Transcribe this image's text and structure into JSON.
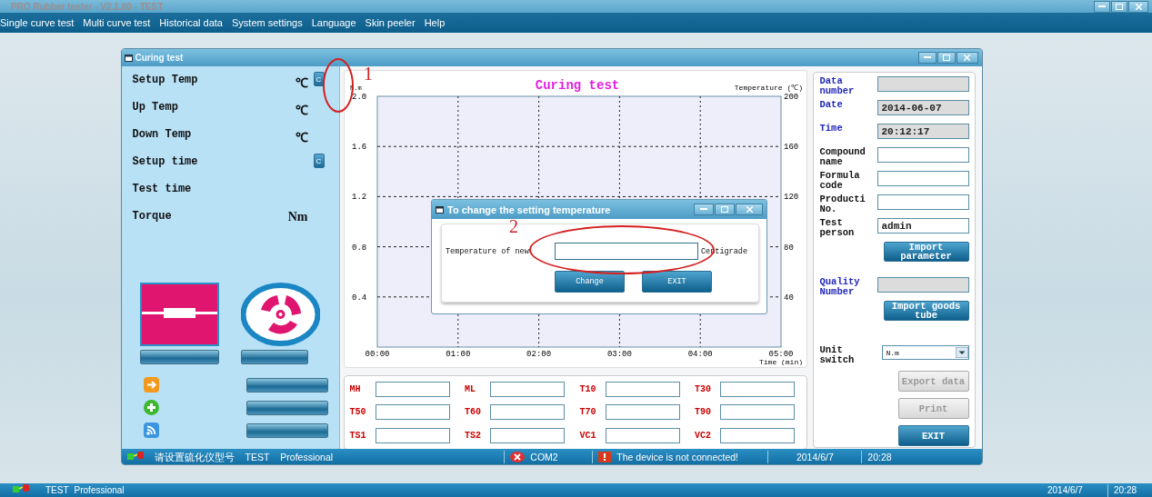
{
  "app": {
    "title": "PRO Rubber tester - V2.1.80 - TEST"
  },
  "menu": [
    "Single curve test",
    "Multi curve test",
    "Historical data",
    "System settings",
    "Language",
    "Skin peeler",
    "Help"
  ],
  "window": {
    "title": "Curing test"
  },
  "readings": [
    {
      "label": "Setup Temp",
      "unit": "℃",
      "button": "C"
    },
    {
      "label": "Up Temp",
      "unit": "℃"
    },
    {
      "label": "Down Temp",
      "unit": "℃"
    },
    {
      "label": "Setup time",
      "button": "C"
    },
    {
      "label": "Test time"
    },
    {
      "label": "Torque",
      "unit": "Nm"
    }
  ],
  "chart": {
    "right_label": "Temperature (℃)",
    "right_ticks": [
      "200",
      "160",
      "120",
      "80",
      "40"
    ],
    "chart_data": {
      "type": "line",
      "grid": true,
      "title": "Curing test",
      "xlabel": "Time (min)",
      "ylabel": "N.m",
      "xlim": [
        0,
        5
      ],
      "ylim": [
        0,
        2.0
      ],
      "xticks": [
        {
          "value": 0,
          "label": "00:00"
        },
        {
          "value": 1,
          "label": "01:00"
        },
        {
          "value": 2,
          "label": "02:00"
        },
        {
          "value": 3,
          "label": "03:00"
        },
        {
          "value": 4,
          "label": "04:00"
        },
        {
          "value": 5,
          "label": "05:00"
        }
      ],
      "yticks": [
        {
          "value": 0.4,
          "label": "0.4"
        },
        {
          "value": 0.8,
          "label": "0.8"
        },
        {
          "value": 1.2,
          "label": "1.2"
        },
        {
          "value": 1.6,
          "label": "1.6"
        },
        {
          "value": 2.0,
          "label": "2.0"
        }
      ]
    }
  },
  "results": [
    "MH",
    "ML",
    "T10",
    "T30",
    "T50",
    "T60",
    "T70",
    "T90",
    "TS1",
    "TS2",
    "VC1",
    "VC2"
  ],
  "info": [
    {
      "kind": "readonly",
      "label": "Data number"
    },
    {
      "kind": "readonly",
      "label": "Date",
      "value": "2014-06-07"
    },
    {
      "kind": "readonly",
      "label": "Time",
      "value": "20:12:17"
    },
    {
      "kind": "input",
      "label": "Compound name"
    },
    {
      "kind": "input",
      "label": "Formula code"
    },
    {
      "kind": "input",
      "label": "Producti No."
    },
    {
      "kind": "input",
      "label": "Test person",
      "value": "admin"
    },
    {
      "kind": "button",
      "label": "Import parameter"
    },
    {
      "kind": "readonly",
      "label": "Quality Number"
    },
    {
      "kind": "button",
      "label": "Import goods tube"
    },
    {
      "kind": "select",
      "label": "Unit switch",
      "value": "N.m"
    }
  ],
  "actions": [
    {
      "label": "Export data",
      "disabled": true
    },
    {
      "label": "Print",
      "disabled": true
    },
    {
      "label": "EXIT",
      "disabled": false
    }
  ],
  "status": {
    "model": "请设置硫化仪型号",
    "user": "TEST",
    "edition": "Professional",
    "port": "COM2",
    "message": "The device is not connected!",
    "date": "2014/6/7",
    "time": "20:28"
  },
  "dialog": {
    "title": "To change the setting temperature",
    "label": "Temperature of new",
    "unit": "Centigrade",
    "buttons": [
      "Change",
      "EXIT"
    ]
  },
  "annotations": [
    {
      "label": "1"
    },
    {
      "label": "2"
    }
  ],
  "taskbar": {
    "user": "TEST",
    "edition": "Professional",
    "date": "2014/6/7",
    "time": "20:28"
  }
}
